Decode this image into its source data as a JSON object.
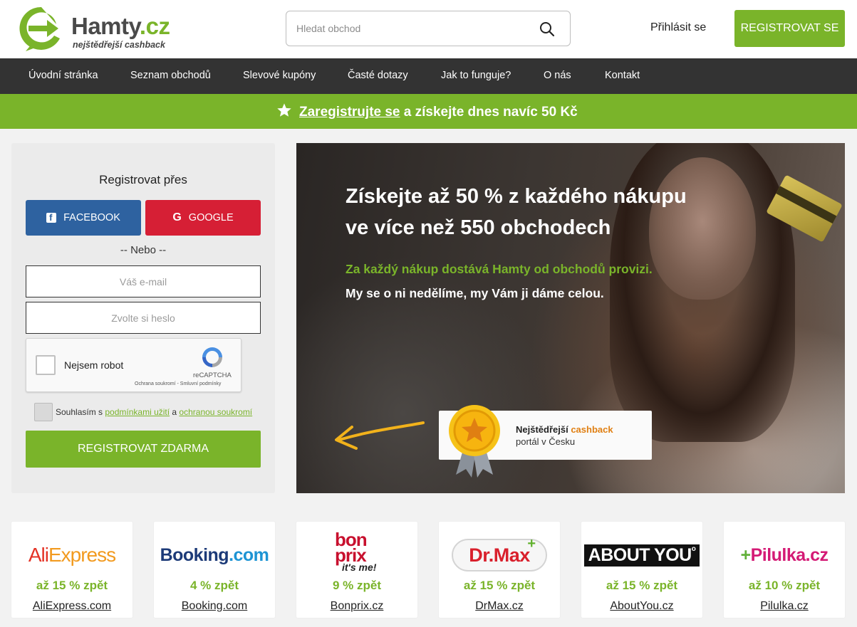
{
  "header": {
    "logo_name": "Hamty",
    "logo_tld": ".cz",
    "logo_tagline": "nejštědřejší cashback",
    "search_placeholder": "Hledat obchod",
    "login_label": "Přihlásit se",
    "register_label": "REGISTROVAT SE"
  },
  "nav": {
    "items": [
      {
        "label": "Úvodní stránka"
      },
      {
        "label": "Seznam obchodů"
      },
      {
        "label": "Slevové kupóny"
      },
      {
        "label": "Časté dotazy"
      },
      {
        "label": "Jak to funguje?"
      },
      {
        "label": "O nás"
      },
      {
        "label": "Kontakt"
      }
    ]
  },
  "promo": {
    "link_text": "Zaregistrujte se",
    "rest_text": " a získejte dnes navíc 50 Kč"
  },
  "register": {
    "title": "Registrovat přes",
    "facebook_label": "FACEBOOK",
    "google_label": "GOOGLE",
    "or_text": "-- Nebo --",
    "email_placeholder": "Váš e-mail",
    "password_placeholder": "Zvolte si heslo",
    "captcha_label": "Nejsem robot",
    "captcha_brand": "reCAPTCHA",
    "captcha_links": "Ochrana soukromí - Smluvní podmínky",
    "agree_prefix": "Souhlasím s ",
    "agree_terms": "podmínkami užití",
    "agree_middle": " a ",
    "agree_privacy": "ochranou soukromí",
    "submit_label": "REGISTROVAT ZDARMA"
  },
  "hero": {
    "title_line1": "Získejte až 50 % z každého nákupu",
    "title_line2": "ve více než 550 obchodech",
    "green_text": "Za každý nákup dostává Hamty od obchodů provizi.",
    "white_text": "My se o ni nedělíme, my Vám ji dáme celou.",
    "badge_bold": "Nejštědřejší ",
    "badge_accent": "cashback",
    "badge_line2": "portál v Česku"
  },
  "shops": [
    {
      "logo": "AliExpress",
      "cashback": "až 15 % zpět",
      "name": "AliExpress.com"
    },
    {
      "logo": "Booking.com",
      "cashback": "4 % zpět",
      "name": "Booking.com"
    },
    {
      "logo": "bon prix it's me!",
      "cashback": "9 % zpět",
      "name": "Bonprix.cz"
    },
    {
      "logo": "Dr.Max",
      "cashback": "až 15 % zpět",
      "name": "DrMax.cz"
    },
    {
      "logo": "ABOUT YOU",
      "cashback": "až 15 % zpět",
      "name": "AboutYou.cz"
    },
    {
      "logo": "Pilulka.cz",
      "cashback": "až 10 % zpět",
      "name": "Pilulka.cz"
    }
  ],
  "colors": {
    "brand_green": "#7ab42a",
    "nav_dark": "#333333",
    "facebook_blue": "#2e62a0",
    "google_red": "#d61f35",
    "accent_orange": "#e07f12"
  }
}
